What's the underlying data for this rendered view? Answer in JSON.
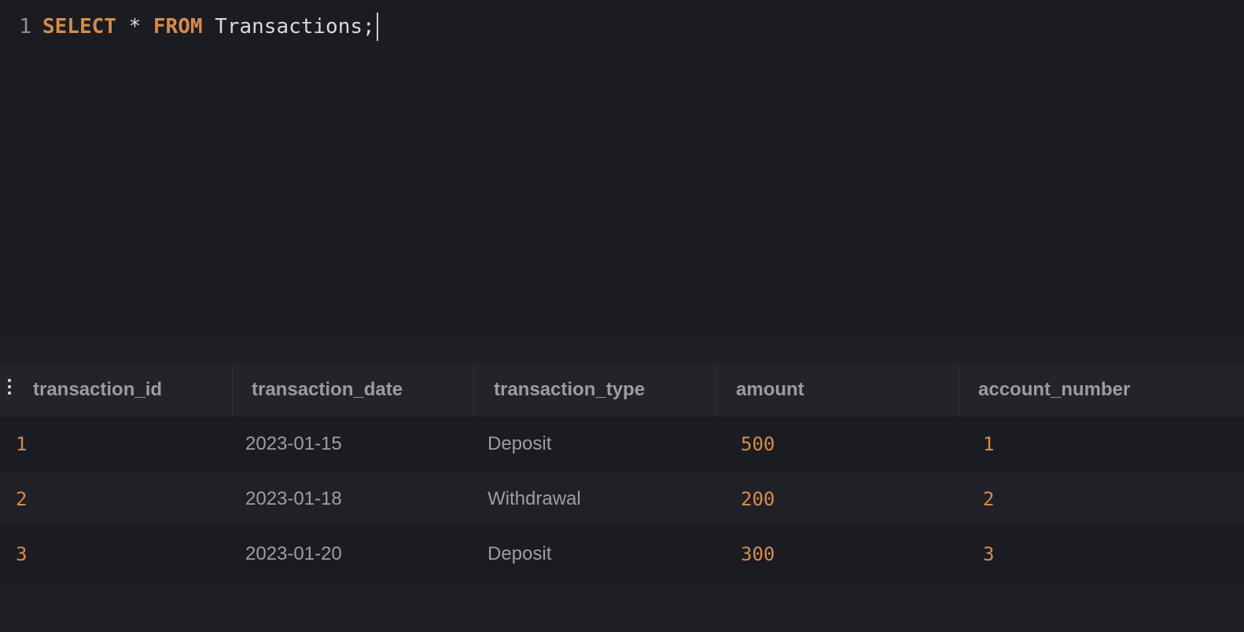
{
  "editor": {
    "line_number": "1",
    "kw_select": "SELECT",
    "star": "*",
    "kw_from": "FROM",
    "table_name": "Transactions;"
  },
  "results": {
    "columns": [
      "transaction_id",
      "transaction_date",
      "transaction_type",
      "amount",
      "account_number"
    ],
    "rows": [
      [
        "1",
        "2023-01-15",
        "Deposit",
        "500",
        "1"
      ],
      [
        "2",
        "2023-01-18",
        "Withdrawal",
        "200",
        "2"
      ],
      [
        "3",
        "2023-01-20",
        "Deposit",
        "300",
        "3"
      ]
    ]
  },
  "icons": {
    "column_menu": "vertical-dots-icon"
  },
  "colors": {
    "background": "#1b1c21",
    "keyword": "#d58b4e",
    "number": "#d58b4e",
    "header_text": "#9a9ca3",
    "cell_text": "#9c9ea5"
  }
}
